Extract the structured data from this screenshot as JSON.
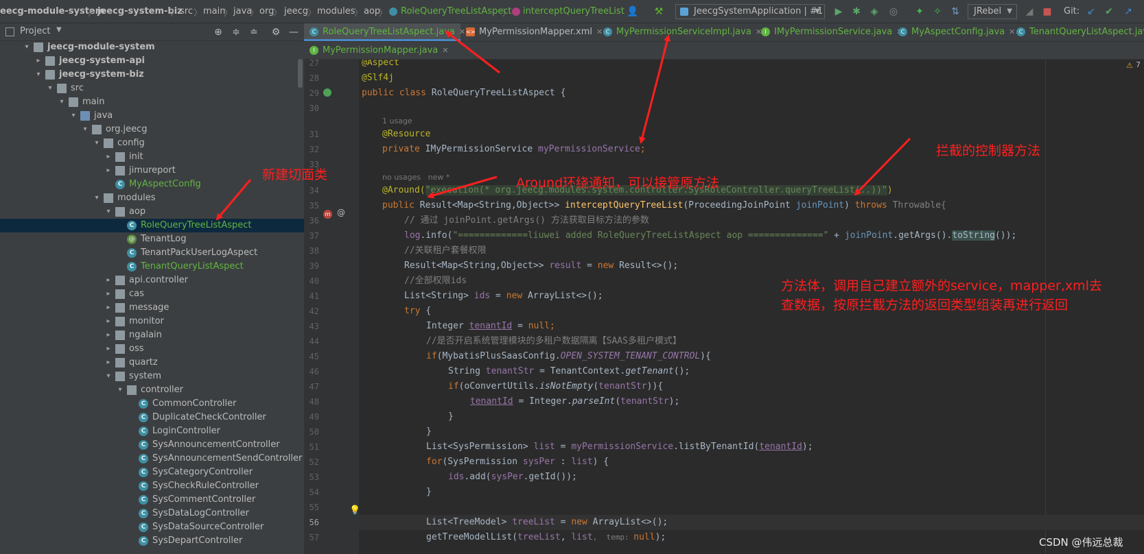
{
  "breadcrumb": [
    "eecg-module-system",
    "jeecg-system-biz",
    "src",
    "main",
    "java",
    "org",
    "jeecg",
    "modules",
    "aop",
    "RoleQueryTreeListAspect",
    "interceptQueryTreeList"
  ],
  "toolbar": {
    "run_config": "JeecgSystemApplication | #1",
    "jrebel": "JRebel",
    "git_label": "Git:"
  },
  "project_panel": {
    "title": "Project"
  },
  "tree": [
    {
      "depth": 1,
      "label": "jeecg-module-system",
      "bold": true,
      "icon": "module-folder-icon",
      "expanded": true
    },
    {
      "depth": 2,
      "label": "jeecg-system-api",
      "bold": true,
      "icon": "module-folder-icon",
      "expanded": false
    },
    {
      "depth": 2,
      "label": "jeecg-system-biz",
      "bold": true,
      "icon": "module-folder-icon",
      "expanded": true
    },
    {
      "depth": 3,
      "label": "src",
      "icon": "folder-icon",
      "expanded": true
    },
    {
      "depth": 4,
      "label": "main",
      "icon": "folder-icon",
      "expanded": true
    },
    {
      "depth": 5,
      "label": "java",
      "icon": "source-folder-icon",
      "expanded": true
    },
    {
      "depth": 6,
      "label": "org.jeecg",
      "icon": "package-icon",
      "expanded": true
    },
    {
      "depth": 7,
      "label": "config",
      "icon": "package-icon",
      "expanded": true
    },
    {
      "depth": 8,
      "label": "init",
      "icon": "package-icon",
      "expanded": false
    },
    {
      "depth": 8,
      "label": "jimureport",
      "icon": "package-icon",
      "expanded": false
    },
    {
      "depth": 8,
      "label": "MyAspectConfig",
      "icon": "class-icon",
      "leaf": true,
      "new": true
    },
    {
      "depth": 7,
      "label": "modules",
      "icon": "package-icon",
      "expanded": true
    },
    {
      "depth": 8,
      "label": "aop",
      "icon": "package-icon",
      "expanded": true
    },
    {
      "depth": 9,
      "label": "RoleQueryTreeListAspect",
      "icon": "class-icon",
      "leaf": true,
      "new": true,
      "selected": true
    },
    {
      "depth": 9,
      "label": "TenantLog",
      "icon": "annotation-icon",
      "leaf": true
    },
    {
      "depth": 9,
      "label": "TenantPackUserLogAspect",
      "icon": "class-icon",
      "leaf": true
    },
    {
      "depth": 9,
      "label": "TenantQueryListAspect",
      "icon": "class-icon",
      "leaf": true,
      "new": true
    },
    {
      "depth": 8,
      "label": "api.controller",
      "icon": "package-icon",
      "expanded": false
    },
    {
      "depth": 8,
      "label": "cas",
      "icon": "package-icon",
      "expanded": false
    },
    {
      "depth": 8,
      "label": "message",
      "icon": "package-icon",
      "expanded": false
    },
    {
      "depth": 8,
      "label": "monitor",
      "icon": "package-icon",
      "expanded": false
    },
    {
      "depth": 8,
      "label": "ngalain",
      "icon": "package-icon",
      "expanded": false
    },
    {
      "depth": 8,
      "label": "oss",
      "icon": "package-icon",
      "expanded": false
    },
    {
      "depth": 8,
      "label": "quartz",
      "icon": "package-icon",
      "expanded": false
    },
    {
      "depth": 8,
      "label": "system",
      "icon": "package-icon",
      "expanded": true
    },
    {
      "depth": 9,
      "label": "controller",
      "icon": "package-icon",
      "expanded": true
    },
    {
      "depth": 10,
      "label": "CommonController",
      "icon": "class-icon",
      "leaf": true
    },
    {
      "depth": 10,
      "label": "DuplicateCheckController",
      "icon": "class-icon",
      "leaf": true
    },
    {
      "depth": 10,
      "label": "LoginController",
      "icon": "class-icon",
      "leaf": true
    },
    {
      "depth": 10,
      "label": "SysAnnouncementController",
      "icon": "class-icon",
      "leaf": true
    },
    {
      "depth": 10,
      "label": "SysAnnouncementSendController",
      "icon": "class-icon",
      "leaf": true
    },
    {
      "depth": 10,
      "label": "SysCategoryController",
      "icon": "class-icon",
      "leaf": true
    },
    {
      "depth": 10,
      "label": "SysCheckRuleController",
      "icon": "class-icon",
      "leaf": true
    },
    {
      "depth": 10,
      "label": "SysCommentController",
      "icon": "class-icon",
      "leaf": true
    },
    {
      "depth": 10,
      "label": "SysDataLogController",
      "icon": "class-icon",
      "leaf": true
    },
    {
      "depth": 10,
      "label": "SysDataSourceController",
      "icon": "class-icon",
      "leaf": true
    },
    {
      "depth": 10,
      "label": "SysDepartController",
      "icon": "class-icon",
      "leaf": true
    }
  ],
  "tabs_row1": [
    {
      "label": "RoleQueryTreeListAspect.java",
      "icon": "class-icon",
      "active": true,
      "color": "#62b543"
    },
    {
      "label": "MyPermissionMapper.xml",
      "icon": "xml-icon",
      "color": "#bbbbbb"
    },
    {
      "label": "MyPermissionServiceImpl.java",
      "icon": "class-icon",
      "color": "#62b543"
    },
    {
      "label": "IMyPermissionService.java",
      "icon": "interface-icon",
      "color": "#62b543"
    },
    {
      "label": "MyAspectConfig.java",
      "icon": "class-icon",
      "color": "#62b543"
    },
    {
      "label": "TenantQueryListAspect.java",
      "icon": "class-icon",
      "color": "#62b543"
    }
  ],
  "tabs_row2": [
    {
      "label": "MyPermissionMapper.java",
      "icon": "interface-icon",
      "color": "#62b543"
    }
  ],
  "editor": {
    "warning_count": "7",
    "line_numbers": [
      "27",
      "28",
      "29",
      "30",
      "",
      "31",
      "32",
      "33",
      "",
      "34",
      "35",
      "36",
      "37",
      "38",
      "39",
      "40",
      "41",
      "42",
      "43",
      "44",
      "45",
      "46",
      "47",
      "48",
      "49",
      "50",
      "51",
      "52",
      "53",
      "54",
      "55",
      "56",
      "57"
    ],
    "hints": {
      "usage1": "1 usage",
      "usage2": "no usages   new *"
    },
    "code": {
      "l27": "@Aspect",
      "l28": "@Slf4j",
      "l29_kw": "public class ",
      "l29_name": "RoleQueryTreeListAspect {",
      "l31": "@Resource",
      "l32_kw": "private ",
      "l32_type": "IMyPermissionService ",
      "l32_field": "myPermissionService",
      "l32_end": ";",
      "l34_anno": "@Around(",
      "l34_str": "\"execution(* org.jeecg.modules.system.controller.SysRoleController.queryTreeList(..))\"",
      "l34_end": ")",
      "l35_kw": "public ",
      "l35_type": "Result<Map<String,Object>> ",
      "l35_fn": "interceptQueryTreeList",
      "l35_params": "(ProceedingJoinPoint ",
      "l35_param": "joinPoint",
      "l35_close": ") ",
      "l35_throws": "throws ",
      "l35_tail": "Throwable{",
      "l36": "// 通过 joinPoint.getArgs() 方法获取目标方法的参数",
      "l37_a": "log",
      "l37_b": ".info(",
      "l37_str": "\"=============liuwei added RoleQueryTreeListAspect aop ==============\"",
      "l37_c": " + ",
      "l37_d": "joinPoint",
      "l37_e": ".getArgs().",
      "l37_f": "toString",
      "l37_g": "());",
      "l38": "//关联租户套餐权限",
      "l39_a": "Result<Map<String,Object>> ",
      "l39_b": "result",
      "l39_c": " = ",
      "l39_d": "new ",
      "l39_e": "Result<>();",
      "l40": "//全部权限ids",
      "l41_a": "List<String> ",
      "l41_b": "ids",
      "l41_c": " = ",
      "l41_d": "new ",
      "l41_e": "ArrayList<>();",
      "l42_kw": "try ",
      "l42_b": "{",
      "l43_a": "Integer ",
      "l43_b": "tenantId",
      "l43_c": " = ",
      "l43_d": "null",
      "l43_e": ";",
      "l44": "//是否开启系统管理模块的多租户数据隔离【SAAS多租户模式】",
      "l45_kw": "if",
      "l45_a": "(MybatisPlusSaasConfig.",
      "l45_b": "OPEN_SYSTEM_TENANT_CONTROL",
      "l45_c": "){",
      "l46_a": "String ",
      "l46_b": "tenantStr",
      "l46_c": " = TenantContext.",
      "l46_d": "getTenant",
      "l46_e": "();",
      "l47_kw": "if",
      "l47_a": "(oConvertUtils.",
      "l47_b": "isNotEmpty",
      "l47_c": "(",
      "l47_d": "tenantStr",
      "l47_e": ")){",
      "l48_a": "tenantId",
      "l48_b": " = Integer.",
      "l48_c": "parseInt",
      "l48_d": "(",
      "l48_e": "tenantStr",
      "l48_f": ");",
      "l49": "}",
      "l50": "}",
      "l51_a": "List<SysPermission> ",
      "l51_b": "list",
      "l51_c": " = ",
      "l51_d": "myPermissionService",
      "l51_e": ".listByTenantId(",
      "l51_f": "tenantId",
      "l51_g": ");",
      "l52_kw": "for",
      "l52_a": "(SysPermission ",
      "l52_b": "sysPer",
      "l52_c": " : ",
      "l52_d": "list",
      "l52_e": ") {",
      "l53_a": "ids",
      "l53_b": ".add(",
      "l53_c": "sysPer",
      "l53_d": ".getId());",
      "l54": "}",
      "l56_a": "List<TreeModel> ",
      "l56_b": "treeList",
      "l56_c": " = ",
      "l56_d": "new ",
      "l56_e": "ArrayList<>();",
      "l57_a": "getTreeModelList(",
      "l57_b": "treeList",
      "l57_c": ", ",
      "l57_d": "list",
      "l57_e": ",  temp: ",
      "l57_f": "null",
      "l57_g": ");"
    }
  },
  "annotations": {
    "new_aspect": "新建切面类",
    "around": "Around环绕通知，可以接管原方法",
    "intercepted": "拦截的控制器方法",
    "body1": "方法体，调用自己建立额外的service，mapper,xml去",
    "body2": "查数据，按原拦截方法的返回类型组装再进行返回"
  },
  "watermark": "CSDN @伟远总裁"
}
